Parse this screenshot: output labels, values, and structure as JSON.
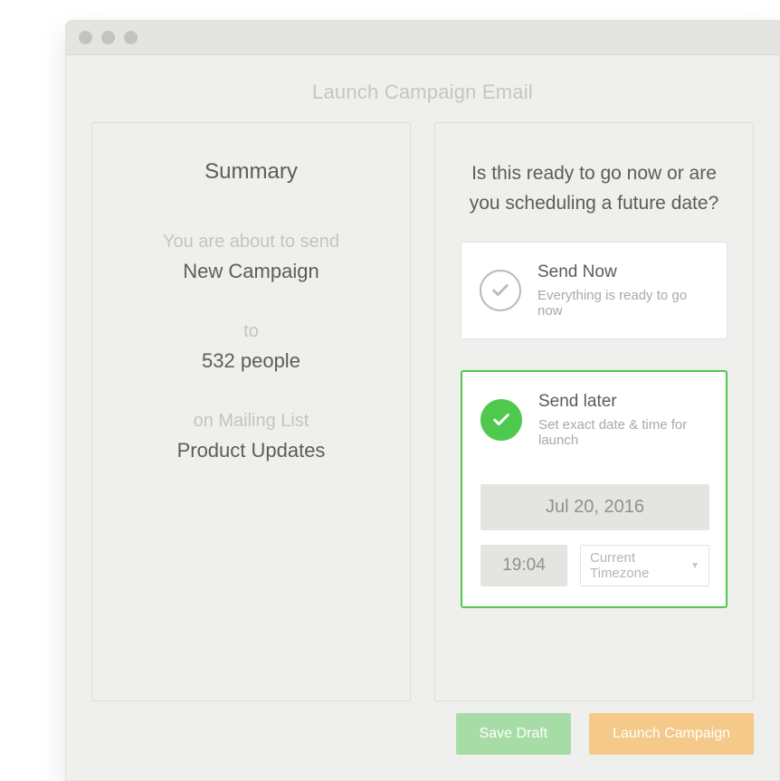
{
  "header": {
    "title": "Launch Campaign Email"
  },
  "summary": {
    "heading": "Summary",
    "line1": "You are about to send",
    "campaign": "New Campaign",
    "to_label": "to",
    "recipients": "532 people",
    "list_label": "on Mailing List",
    "list_name": "Product Updates"
  },
  "schedule": {
    "prompt": "Is this ready to go now or are you scheduling a future date?",
    "send_now": {
      "title": "Send Now",
      "subtitle": "Everything is ready to go now"
    },
    "send_later": {
      "title": "Send later",
      "subtitle": "Set exact date & time for launch",
      "date": "Jul 20, 2016",
      "time": "19:04",
      "timezone": "Current Timezone"
    }
  },
  "actions": {
    "save_draft": "Save Draft",
    "launch": "Launch Campaign"
  }
}
